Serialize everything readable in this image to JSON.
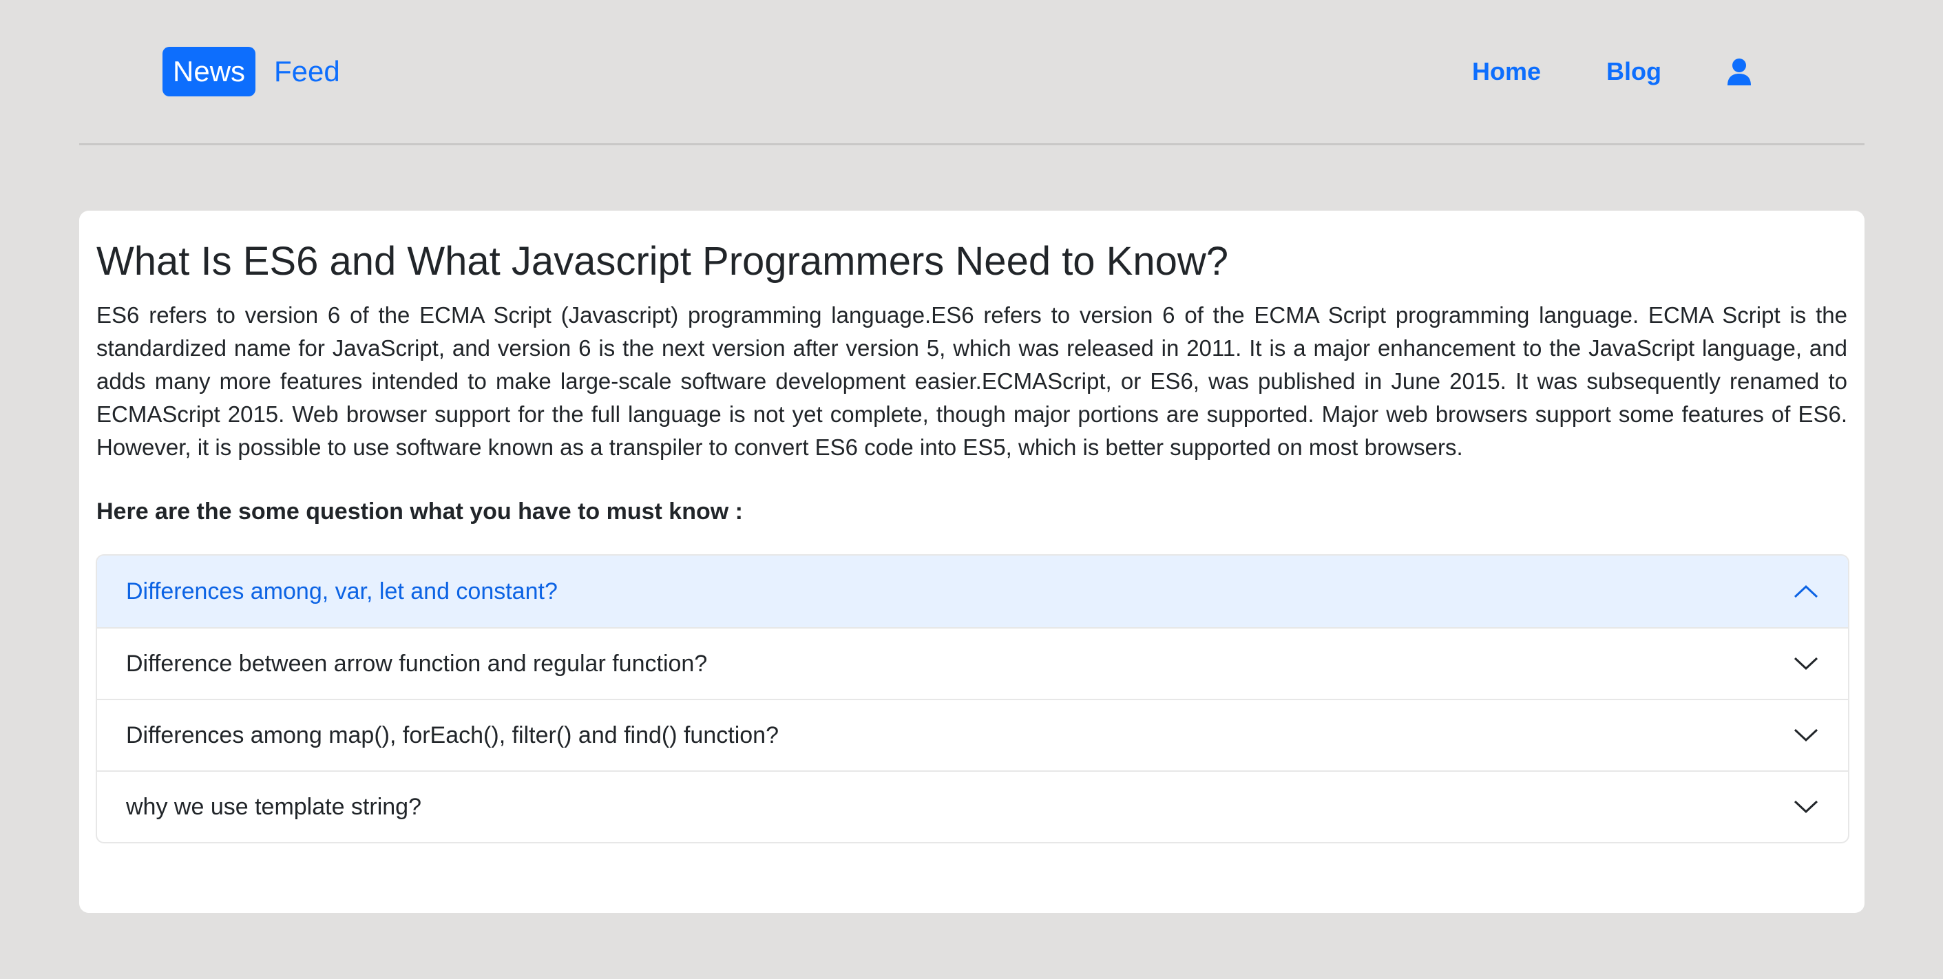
{
  "header": {
    "brand_badge": "News",
    "brand_text": "Feed",
    "nav": [
      {
        "label": "Home"
      },
      {
        "label": "Blog"
      }
    ],
    "user_icon": "user-icon"
  },
  "article": {
    "title": "What Is ES6 and What Javascript Programmers Need to Know?",
    "body": "ES6 refers to version 6 of the ECMA Script (Javascript) programming language.ES6 refers to version 6 of the ECMA Script programming language. ECMA Script is the standardized name for JavaScript, and version 6 is the next version after version 5, which was released in 2011. It is a major enhancement to the JavaScript language, and adds many more features intended to make large-scale software development easier.ECMAScript, or ES6, was published in June 2015. It was subsequently renamed to ECMAScript 2015. Web browser support for the full language is not yet complete, though major portions are supported. Major web browsers support some features of ES6. However, it is possible to use software known as a transpiler to convert ES6 code into ES5, which is better supported on most browsers.",
    "subtitle": "Here are the some question what you have to must know :"
  },
  "accordion": [
    {
      "question": "Differences among, var, let and constant?",
      "expanded": true,
      "icon": "chevron-up-icon"
    },
    {
      "question": "Difference between arrow function and regular function?",
      "expanded": false,
      "icon": "chevron-down-icon"
    },
    {
      "question": "Differences among map(), forEach(), filter() and find() function?",
      "expanded": false,
      "icon": "chevron-down-icon"
    },
    {
      "question": "why we use template string?",
      "expanded": false,
      "icon": "chevron-down-icon"
    }
  ],
  "colors": {
    "primary": "#0d6efd",
    "page_background": "#e1e0df",
    "accordion_active_bg": "#e7f1ff",
    "accordion_active_text": "#0c63e4"
  }
}
